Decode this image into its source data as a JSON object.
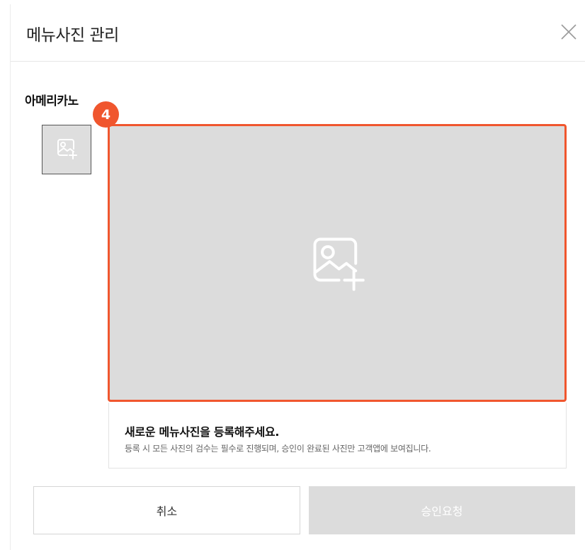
{
  "modal": {
    "title": "메뉴사진 관리",
    "close_icon": "close-icon"
  },
  "menu": {
    "name": "아메리카노"
  },
  "step_badge": "4",
  "upload": {
    "icon": "image-add-icon",
    "highlight_color": "#f0562e"
  },
  "info": {
    "title": "새로운 메뉴사진을 등록해주세요.",
    "description": "등록 시 모든 사진의 검수는 필수로 진행되며, 승인이 완료된 사진만 고객앱에 보여집니다."
  },
  "buttons": {
    "cancel": "취소",
    "request_approval": "승인요청"
  }
}
